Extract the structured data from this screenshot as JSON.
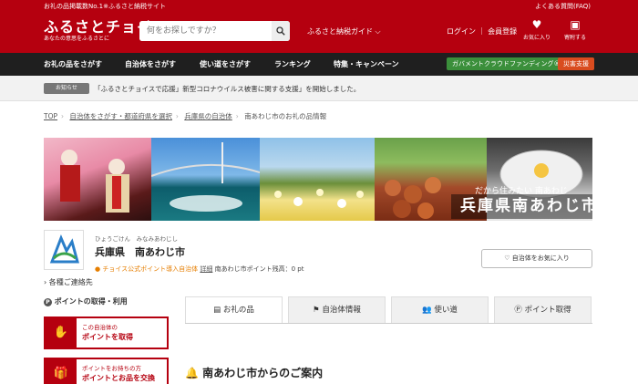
{
  "header": {
    "tagline": "お礼の品掲載数No.1※ふるさと納税サイト",
    "faq": "よくある質問(FAQ)",
    "logo": "ふるさとチョイス",
    "logo_sub": "あなたの意思をふるさとに",
    "search_placeholder": "何をお探しですか？",
    "guide": "ふるさと納税ガイド",
    "login": "ログイン",
    "register": "会員登録",
    "favorites": "お気に入り",
    "application_list": "寄附する"
  },
  "nav": {
    "items": [
      "お礼の品をさがす",
      "自治体をさがす",
      "使い道をさがす",
      "ランキング",
      "特集・キャンペーン"
    ],
    "gcf": "ガバメントクラウドファンディング®",
    "disaster": "災害支援"
  },
  "notice": {
    "badge": "お知らせ",
    "text": "「ふるさとチョイスで応援」新型コロナウイルス被害に関する支援」を開始しました。"
  },
  "breadcrumb": [
    "TOP",
    "自治体をさがす・都道府県を選択",
    "兵庫県の自治体",
    "南あわじ市のお礼の品情報"
  ],
  "banner": {
    "catch": "だから住みたい 南あわじ",
    "title": "兵庫県南あわじ市"
  },
  "municipality": {
    "kana": "ひょうごけん　みなみあわじし",
    "name": "兵庫県　南あわじ市",
    "points_label": "チョイス公式ポイント導入自治体",
    "detail": "詳細",
    "balance": "南あわじ市ポイント残高：0 pt",
    "favorite_button": "自治体をお気に入り",
    "contact": "各種ご連絡先"
  },
  "points_section": {
    "title": "ポイントの取得・利用",
    "cards": [
      {
        "line1": "この自治体の",
        "line2": "ポイントを取得"
      },
      {
        "line1": "ポイントをお持ちの方",
        "line2": "ポイントとお品を交換"
      }
    ]
  },
  "tabs": [
    "お礼の品",
    "自治体情報",
    "使い道",
    "ポイント取得"
  ],
  "guidance_title": "南あわじ市からのご案内",
  "colors": {
    "brand": "#b5000f",
    "nav": "#1f1f1f",
    "gcf": "#3b8f3b",
    "disaster": "#d94c1f"
  }
}
